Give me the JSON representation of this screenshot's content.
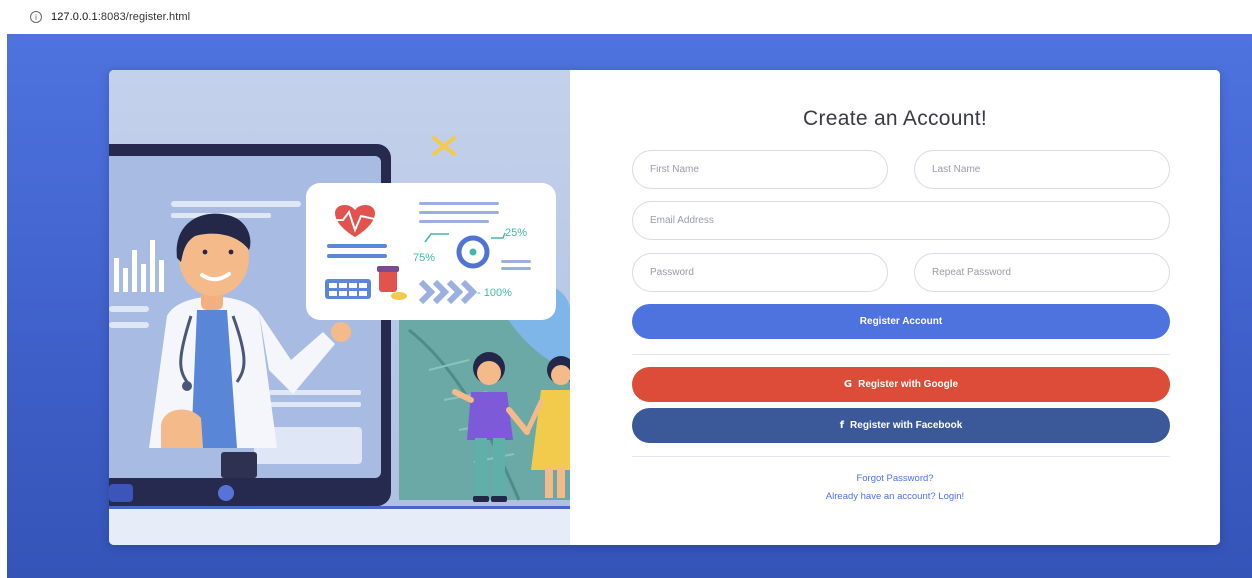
{
  "browser": {
    "url_host": "127.0.0.1",
    "url_rest": ":8083/register.html"
  },
  "illustration": {
    "pct_75": "75%",
    "pct_25": "25%",
    "pct_100": "- 100%"
  },
  "form": {
    "title": "Create an Account!",
    "first_name_placeholder": "First Name",
    "last_name_placeholder": "Last Name",
    "email_placeholder": "Email Address",
    "password_placeholder": "Password",
    "repeat_password_placeholder": "Repeat Password",
    "register_label": "Register Account",
    "google_label": "Register with Google",
    "facebook_label": "Register with Facebook",
    "forgot_password": "Forgot Password?",
    "login_link": "Already have an account? Login!"
  },
  "colors": {
    "primary": "#4e73df",
    "google": "#dd4b39",
    "facebook": "#3b5998"
  },
  "icons": {
    "google": "google-icon",
    "facebook": "facebook-icon",
    "site_info": "info-icon"
  }
}
